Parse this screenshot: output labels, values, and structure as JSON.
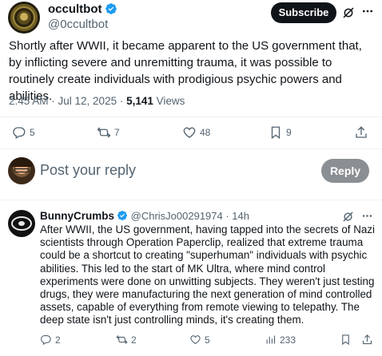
{
  "post": {
    "display_name": "occultbot",
    "handle": "@0ccultbot",
    "subscribe_label": "Subscribe",
    "text": "Shortly after WWII, it became apparent to the US government that, by inflicting severe and unremitting trauma, it was possible to routinely create individuals with prodigious psychic powers and abilities.",
    "time": "2:45 AM · Jul 12, 2025 · ",
    "views_count": "5,141",
    "views_label": " Views",
    "stats": {
      "replies": "5",
      "reposts": "7",
      "likes": "48",
      "bookmarks": "9"
    }
  },
  "reply_box": {
    "placeholder": "Post your reply",
    "button_label": "Reply"
  },
  "reply": {
    "display_name": "BunnyCrumbs",
    "handle_time": "@ChrisJo00291974 · 14h",
    "text": "After WWII, the US government, having tapped into the secrets of Nazi scientists through Operation Paperclip, realized that extreme trauma could be a shortcut to creating \"superhuman\" individuals with psychic abilities. This led to the start of MK Ultra, where mind control experiments were done on unwitting subjects. They weren't just testing drugs, they were manufacturing the next generation of mind controlled assets, capable of everything from remote viewing to telepathy. The deep state isn't just controlling minds, it's creating them.",
    "stats": {
      "replies": "2",
      "reposts": "2",
      "likes": "5",
      "views": "233"
    }
  },
  "colors": {
    "verified": "#1d9bf0",
    "text_primary": "#0f1419",
    "text_secondary": "#536471",
    "divider": "#eff3f4"
  },
  "icons": [
    "verified-badge-icon",
    "grok-icon",
    "more-icon",
    "reply-icon",
    "repost-icon",
    "like-icon",
    "bookmark-icon",
    "share-icon",
    "views-icon"
  ]
}
